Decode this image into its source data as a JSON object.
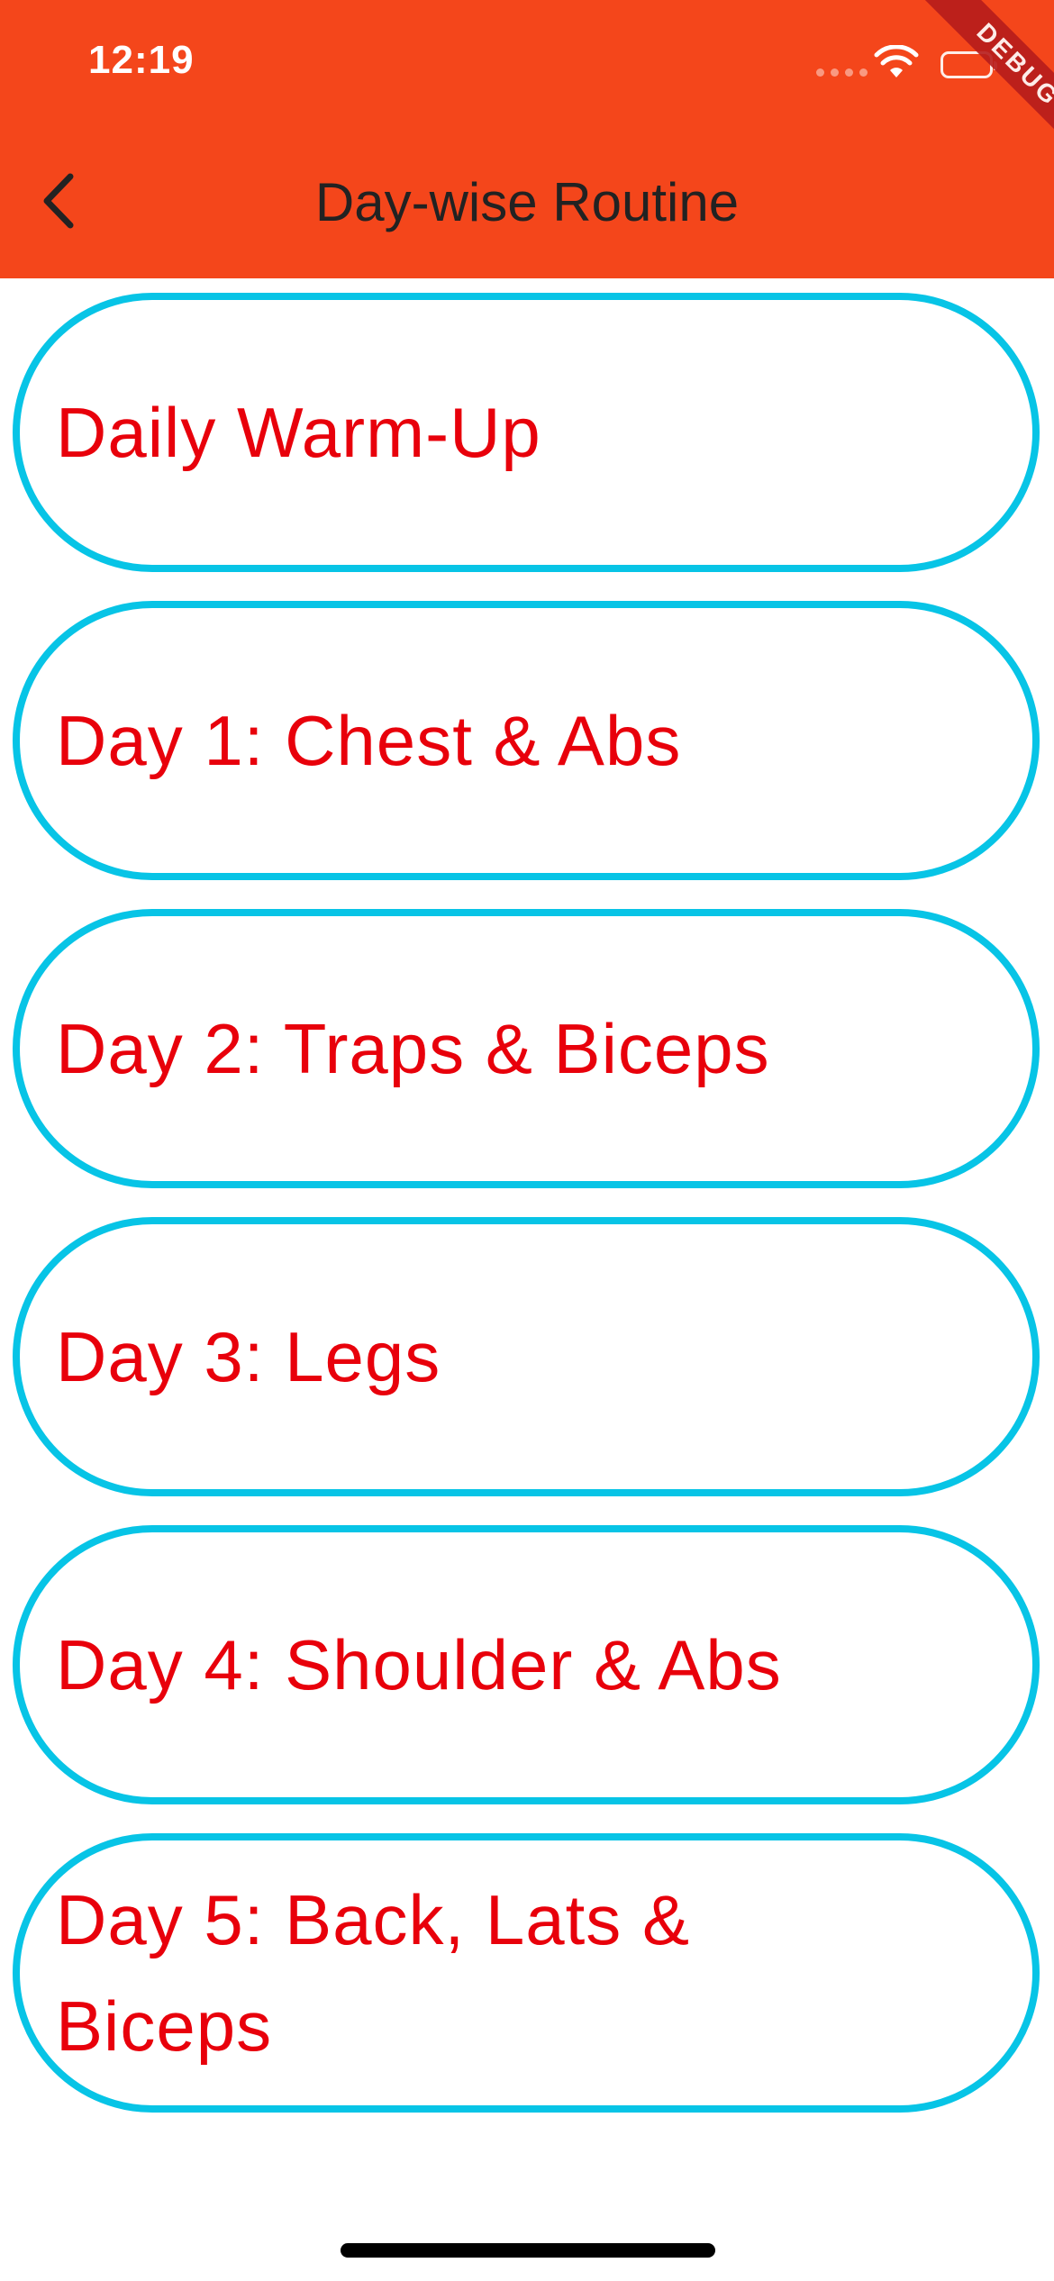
{
  "status_bar": {
    "time": "12:19"
  },
  "debug_banner": "DEBUG",
  "header": {
    "title": "Day-wise Routine"
  },
  "routines": [
    {
      "label": "Daily Warm-Up"
    },
    {
      "label": "Day 1: Chest & Abs"
    },
    {
      "label": "Day 2: Traps & Biceps"
    },
    {
      "label": "Day 3: Legs"
    },
    {
      "label": "Day 4: Shoulder & Abs"
    },
    {
      "label": "Day 5: Back, Lats & Biceps"
    }
  ],
  "colors": {
    "app_bar": "#f4461b",
    "item_border": "#07c4e6",
    "item_text": "#e8000b"
  }
}
